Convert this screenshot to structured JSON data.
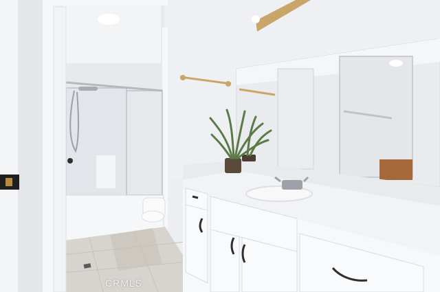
{
  "photo": {
    "watermark": "CRMLS",
    "palette": {
      "wall": "#eeeff2",
      "ceiling": "#f5f6f8",
      "cabinet": "#f7f8f9",
      "countertop": "#f1f2f3",
      "floor_tile": "#d8d6d2",
      "plant": "#5c7a45",
      "pot": "#5a4a3c",
      "wood_dresser": "#a4683a",
      "brass": "#c9a56a",
      "chrome": "#9ea2a8"
    }
  }
}
